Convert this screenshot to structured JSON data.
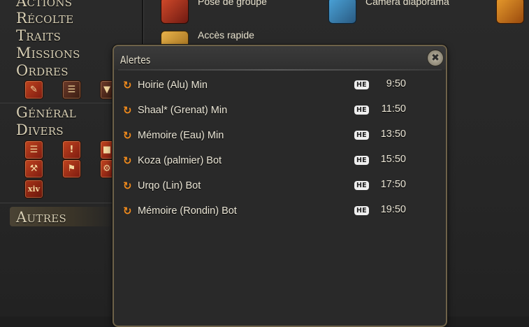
{
  "sidebar": {
    "categories": [
      "Actions",
      "Récolte",
      "Traits",
      "Missions",
      "Ordres",
      "Général",
      "Divers",
      "Autres"
    ],
    "selected": "Autres"
  },
  "tools": {
    "pose": "Pose de groupe",
    "camera": "Caméra diaporama",
    "quick": "Accès rapide"
  },
  "alerts": {
    "title": "Alertes",
    "close_icon": "close-icon",
    "repeat_icon": "repeat-icon",
    "rows": [
      {
        "name": "Hoirie (Alu) Min",
        "tag": "HE",
        "time": "9:50"
      },
      {
        "name": "Shaal* (Grenat) Min",
        "tag": "HE",
        "time": "11:50"
      },
      {
        "name": "Mémoire (Eau) Min",
        "tag": "HE",
        "time": "13:50"
      },
      {
        "name": "Koza (palmier) Bot",
        "tag": "HE",
        "time": "15:50"
      },
      {
        "name": "Urqo (Lin) Bot",
        "tag": "HE",
        "time": "17:50"
      },
      {
        "name": "Mémoire (Rondin) Bot",
        "tag": "HE",
        "time": "19:50"
      }
    ]
  },
  "colors": {
    "accent": "#f08a1c",
    "panel": "#292929",
    "frame": "#6e6249",
    "text": "#ebe6d6"
  }
}
